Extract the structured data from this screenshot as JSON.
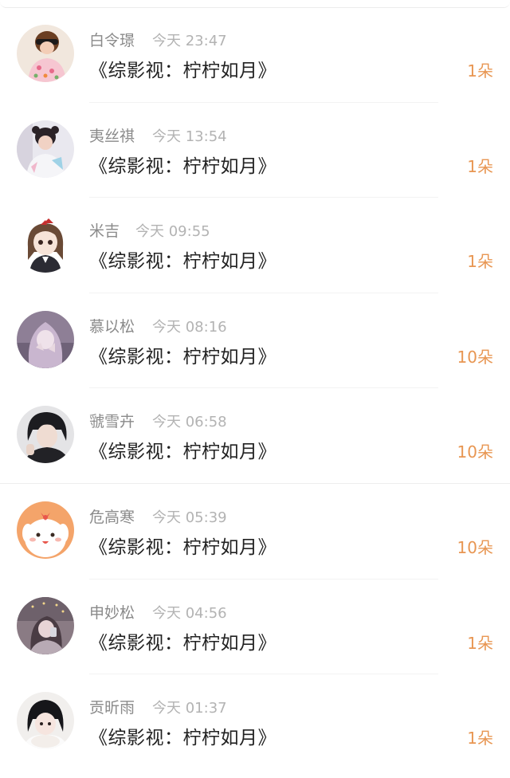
{
  "gifts": [
    {
      "name": "白令璟",
      "time": "今天 23:47",
      "title": "《综影视：柠柠如月》",
      "amount": "1朵",
      "avatar": "girl-sunglasses-avatar"
    },
    {
      "name": "夷丝祺",
      "time": "今天 13:54",
      "title": "《综影视：柠柠如月》",
      "amount": "1朵",
      "avatar": "girl-pigtails-avatar"
    },
    {
      "name": "米吉",
      "time": "今天 09:55",
      "title": "《综影视：柠柠如月》",
      "amount": "1朵",
      "avatar": "anime-girl-avatar"
    },
    {
      "name": "慕以松",
      "time": "今天 08:16",
      "title": "《综影视：柠柠如月》",
      "amount": "10朵",
      "avatar": "purple-girl-avatar"
    },
    {
      "name": "虢雪卉",
      "time": "今天 06:58",
      "title": "《综影视：柠柠如月》",
      "amount": "10朵",
      "avatar": "dark-hair-boy-avatar"
    },
    {
      "name": "危高寒",
      "time": "今天 05:39",
      "title": "《综影视：柠柠如月》",
      "amount": "10朵",
      "avatar": "cartoon-dog-avatar"
    },
    {
      "name": "申妙松",
      "time": "今天 04:56",
      "title": "《综影视：柠柠如月》",
      "amount": "1朵",
      "avatar": "mirror-selfie-avatar"
    },
    {
      "name": "贡昕雨",
      "time": "今天 01:37",
      "title": "《综影视：柠柠如月》",
      "amount": "1朵",
      "avatar": "bob-hair-girl-avatar"
    }
  ],
  "colors": {
    "name": "#8a8a8a",
    "time": "#b3b3b3",
    "title": "#222222",
    "amount": "#e89652"
  }
}
